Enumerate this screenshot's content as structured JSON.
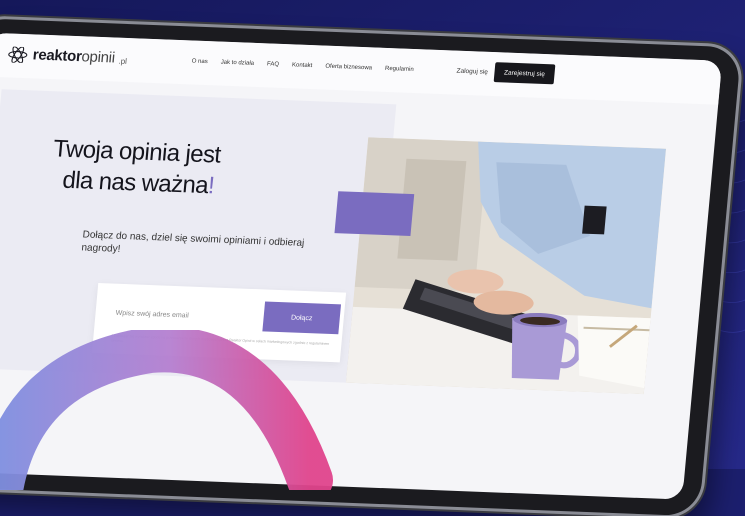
{
  "nav": {
    "logo_bold": "reaktor",
    "logo_light": "opinii",
    "logo_tld": ".pl",
    "menu": [
      "O nas",
      "Jak to działa",
      "FAQ",
      "Kontakt",
      "Oferta biznesowa",
      "Regulamin"
    ],
    "login": "Zaloguj się",
    "register": "Zarejestruj się"
  },
  "hero": {
    "title_line1": "Twoja opinia jest",
    "title_line2": "dla nas ważna",
    "title_accent": "!",
    "subtitle": "Dołącz do nas, dziel się swoimi opiniami i odbieraj nagrody!",
    "email_placeholder": "Wpisz swój adres email",
    "join_button": "Dołącz",
    "consent_note": "* Zapisując się wyrażasz zgodę na przetwarzanie danych osobowych przez Reaktor Opinii w celach marketingowych zgodnie z regulaminem serwisu."
  },
  "colors": {
    "accent": "#7a6cc0",
    "background": "#1c1f6e",
    "dark_button": "#17171c"
  },
  "icons": [
    "logo-icon"
  ]
}
